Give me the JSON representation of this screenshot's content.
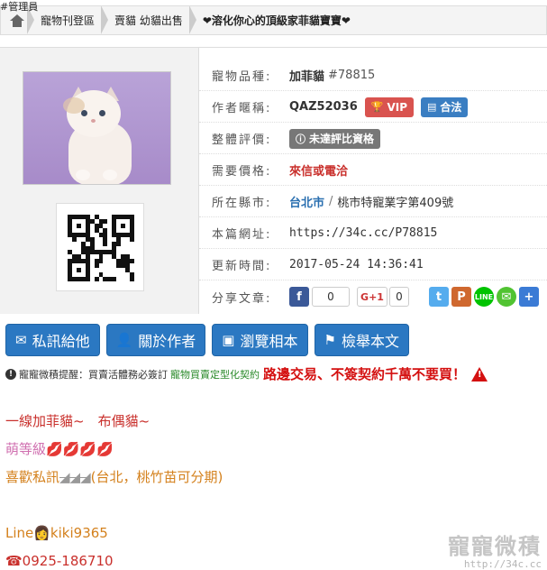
{
  "admin_tag": "#管理員",
  "breadcrumb": {
    "items": [
      "寵物刊登區",
      "賣貓 幼貓出售",
      "❤溶化你心的頂級家菲貓寶寶❤"
    ]
  },
  "fields": {
    "breed_label": "寵物品種:",
    "breed_value": "加菲貓",
    "breed_id": "#78815",
    "author_label": "作者暱稱:",
    "author_value": "QAZ52036",
    "vip_badge": "VIP",
    "legal_badge": "合法",
    "rating_label": "整體評價:",
    "rating_value": "未達評比資格",
    "price_label": "需要價格:",
    "price_value": "來信或電洽",
    "city_label": "所在縣市:",
    "city_value": "台北市",
    "license_value": "桃市特寵業字第409號",
    "url_label": "本篇網址:",
    "url_value": "https://34c.cc/P78815",
    "updated_label": "更新時間:",
    "updated_value": "2017-05-24 14:36:41",
    "share_label": "分享文章:",
    "fb_count": "0",
    "gplus_label": "G+1",
    "gplus_count": "0"
  },
  "actions": {
    "message": "私訊給他",
    "about": "關於作者",
    "album": "瀏覽相本",
    "report": "檢舉本文"
  },
  "notice": {
    "label": "寵寵微積提醒：",
    "text1": "買賣活體務必簽訂",
    "text2": "寵物買賣定型化契約",
    "text3": "路邊交易、不簽契約千萬不要買！"
  },
  "body": {
    "line1": "一線加菲貓~　布偶貓~",
    "line2": "萌等級",
    "line2_lips": "💋💋💋💋",
    "line3a": "喜歡私訊",
    "line3_strike": "◢◢◢",
    "line3b": "(台北，桃竹苗可分期)",
    "line4": "Line👩kiki9365",
    "line5": "☎0925-186710"
  },
  "watermark": {
    "brand": "寵寵微積",
    "url": "http://34c.cc"
  }
}
